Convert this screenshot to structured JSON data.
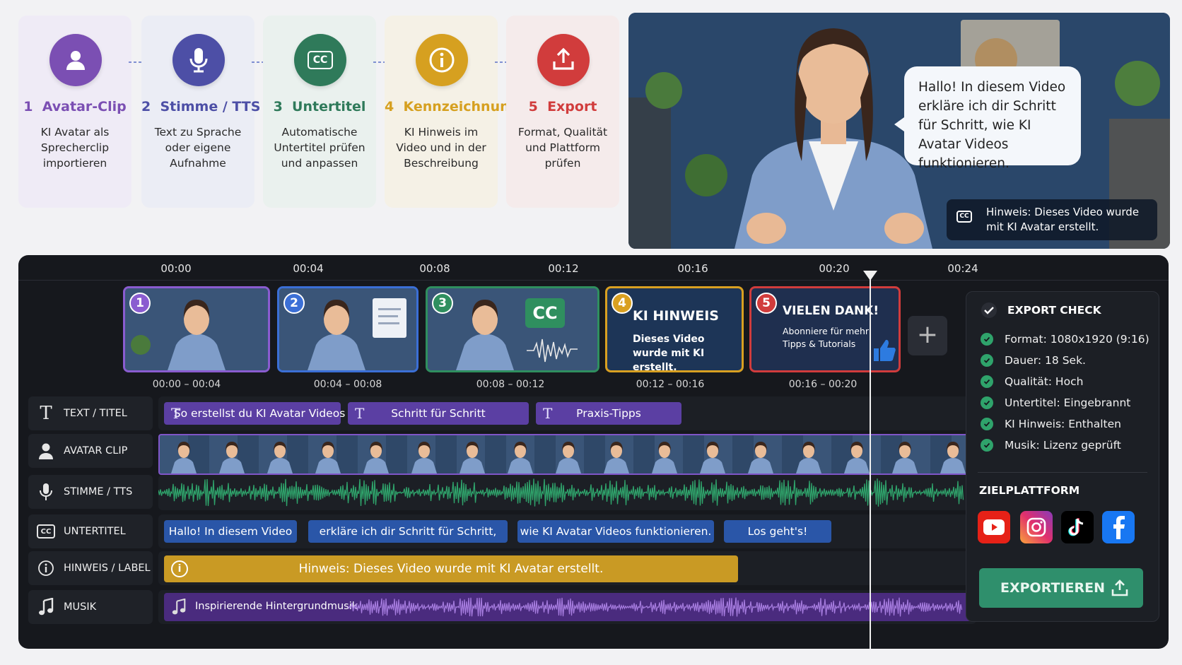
{
  "steps": [
    {
      "number": "1",
      "title": "Avatar-Clip",
      "desc": "KI Avatar als Sprecherclip importieren",
      "color": "#7b4fb3",
      "bg": "#efebf6"
    },
    {
      "number": "2",
      "title": "Stimme / TTS",
      "desc": "Text zu Sprache oder eigene Aufnahme",
      "color": "#4d4fa6",
      "bg": "#ebedf5"
    },
    {
      "number": "3",
      "title": "Untertitel",
      "desc": "Automatische Untertitel prüfen und anpassen",
      "color": "#2f7a5a",
      "bg": "#eaf1ee"
    },
    {
      "number": "4",
      "title": "Kennzeichnung",
      "desc": "KI Hinweis im Video und in der Beschreibung",
      "color": "#d6a020",
      "bg": "#f5f1e6"
    },
    {
      "number": "5",
      "title": "Export",
      "desc": "Format, Qualität und Plattform prüfen",
      "color": "#d13c3c",
      "bg": "#f5ebeb"
    }
  ],
  "preview": {
    "bubble": "Hallo! In diesem Video erkläre ich dir Schritt für Schritt, wie KI Avatar Videos funktionieren.",
    "cc_label": "CC",
    "hint": "Hinweis: Dieses Video wurde mit KI Avatar erstellt."
  },
  "timeline": {
    "ticks": [
      "00:00",
      "00:04",
      "00:08",
      "00:12",
      "00:16",
      "00:20",
      "00:24"
    ],
    "clips": [
      {
        "number": "1",
        "time": "00:00 – 00:04",
        "border": "#8a5cd0"
      },
      {
        "number": "2",
        "time": "00:04 – 00:08",
        "border": "#3b6fd6"
      },
      {
        "number": "3",
        "time": "00:08 – 00:12",
        "border": "#2f8f5f",
        "cc": "CC"
      },
      {
        "number": "4",
        "time": "00:12 – 00:16",
        "border": "#d9a021",
        "title": "KI HINWEIS",
        "sub": "Dieses Video wurde mit KI erstellt."
      },
      {
        "number": "5",
        "time": "00:16 – 00:20",
        "border": "#d13c3c",
        "title": "VIELEN DANK!",
        "sub": "Abonniere für mehr Tipps & Tutorials"
      }
    ],
    "add_label": "+"
  },
  "tracks": [
    {
      "label": "TEXT / TITEL",
      "icon": "text-icon"
    },
    {
      "label": "AVATAR CLIP",
      "icon": "person-icon"
    },
    {
      "label": "STIMME / TTS",
      "icon": "microphone-icon"
    },
    {
      "label": "UNTERTITEL",
      "icon": "cc-icon"
    },
    {
      "label": "HINWEIS / LABEL",
      "icon": "info-icon"
    },
    {
      "label": "MUSIK",
      "icon": "music-note-icon"
    }
  ],
  "text_segments": [
    "So erstellst du KI Avatar Videos",
    "Schritt für Schritt",
    "Praxis-Tipps"
  ],
  "subtitle_segments": [
    "Hallo! In diesem Video",
    "erkläre ich dir Schritt für Schritt,",
    "wie KI Avatar Videos funktionieren.",
    "Los geht's!"
  ],
  "hint_segment": "Hinweis: Dieses Video wurde mit KI Avatar erstellt.",
  "music_segment": "Inspirierende Hintergrundmusik",
  "export_panel": {
    "title": "EXPORT CHECK",
    "checks": [
      "Format: 1080x1920 (9:16)",
      "Dauer: 18 Sek.",
      "Qualität: Hoch",
      "Untertitel: Eingebrannt",
      "KI Hinweis: Enthalten",
      "Musik: Lizenz geprüft"
    ],
    "platform_title": "ZIELPLATTFORM",
    "platforms": [
      {
        "name": "youtube-icon",
        "color": "#e62117"
      },
      {
        "name": "instagram-icon",
        "color": "#c13584"
      },
      {
        "name": "tiktok-icon",
        "color": "#000000"
      },
      {
        "name": "facebook-icon",
        "color": "#1877f2"
      }
    ],
    "button": "EXPORTIEREN"
  }
}
